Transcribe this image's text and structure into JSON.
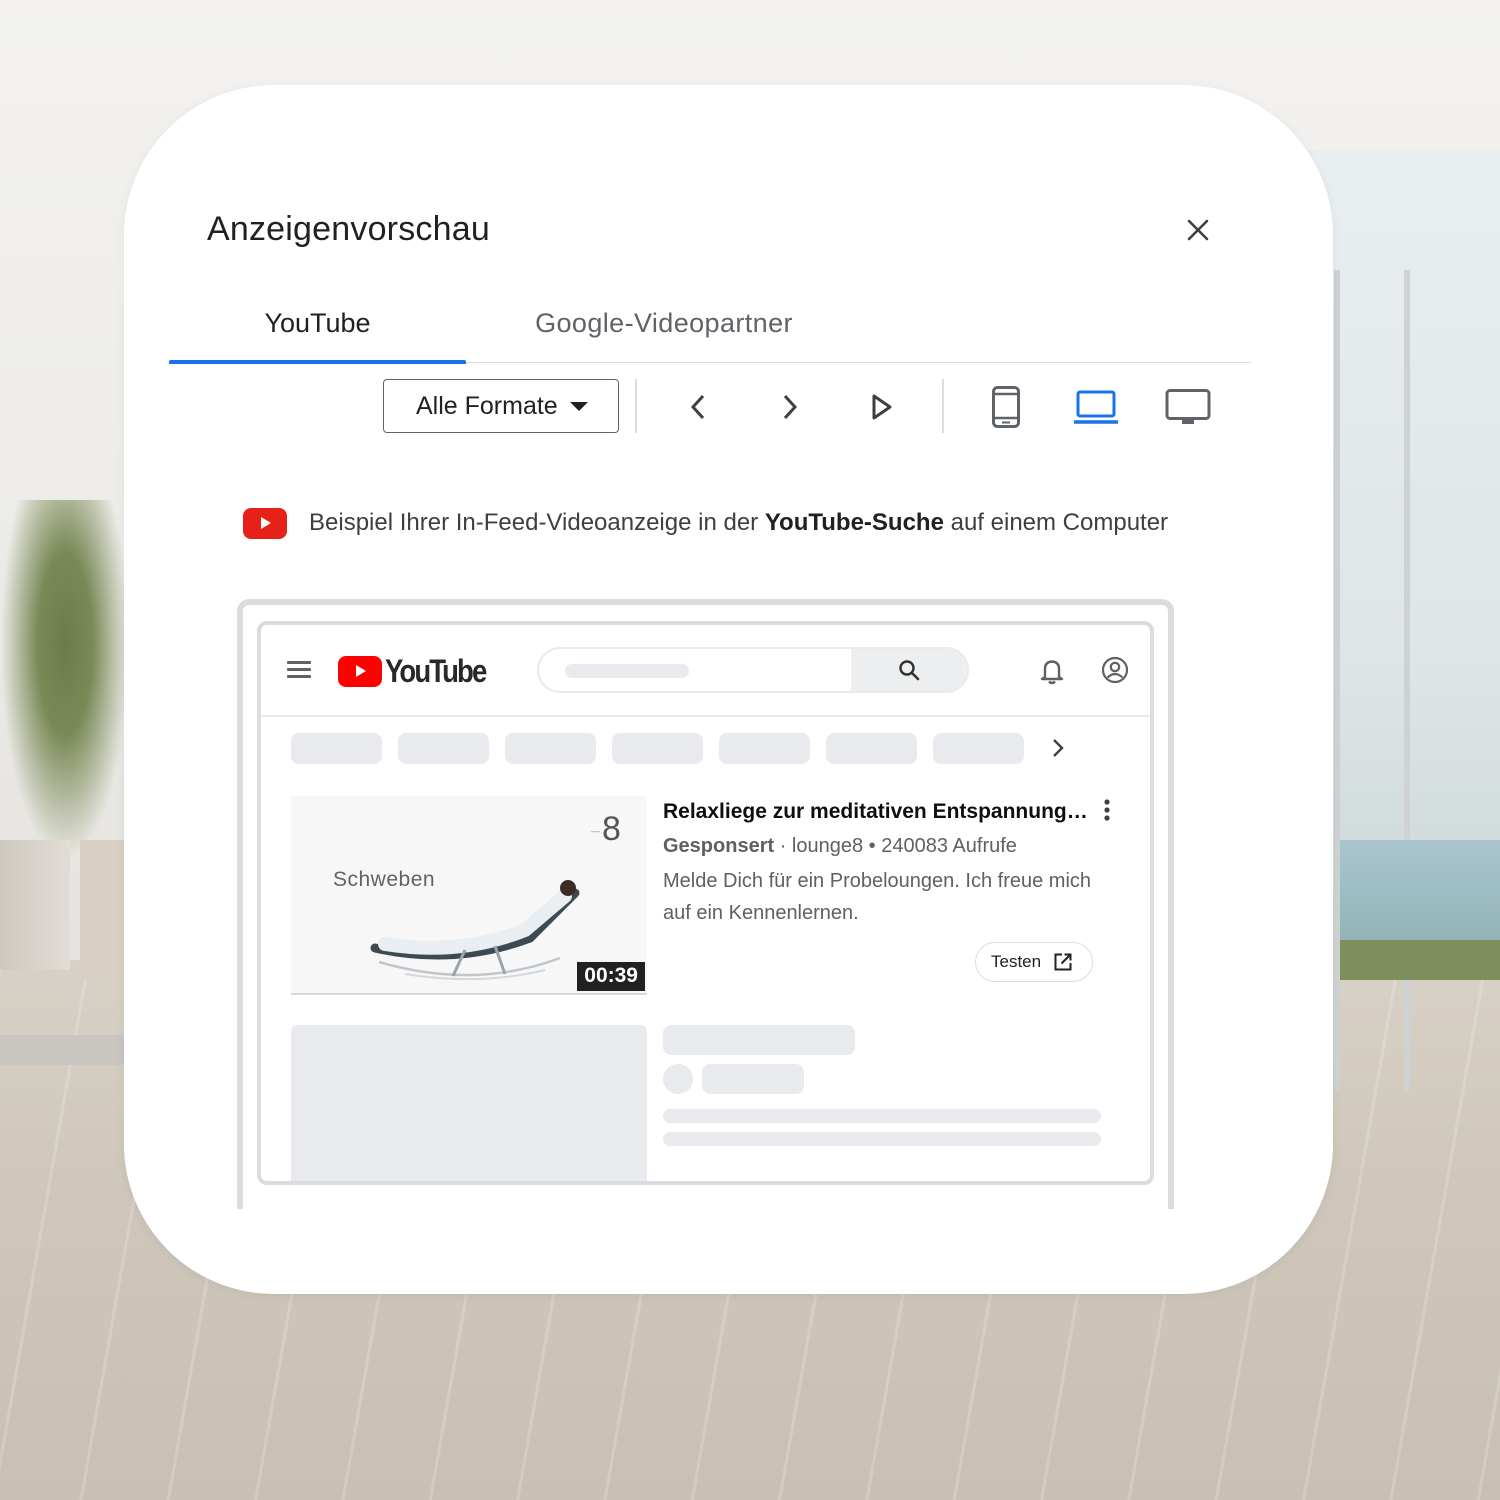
{
  "dialog": {
    "title": "Anzeigenvorschau",
    "close_icon": "close-icon"
  },
  "tabs": [
    {
      "label": "YouTube",
      "active": true
    },
    {
      "label": "Google-Videopartner",
      "active": false
    }
  ],
  "toolbar": {
    "format_select": {
      "value": "Alle Formate"
    },
    "icons": [
      "chevron-left-icon",
      "chevron-right-icon",
      "play-icon",
      "phone-icon",
      "laptop-icon",
      "monitor-icon"
    ],
    "selected_device": "laptop"
  },
  "info": {
    "prefix": "Beispiel Ihrer In-Feed-Videoanzeige in der ",
    "bold": "YouTube-Suche",
    "suffix": " auf einem Computer"
  },
  "preview": {
    "logo_text": "YouTube",
    "ad": {
      "thumbnail_brand": "8",
      "thumbnail_caption": "Schweben",
      "duration": "00:39",
      "title": "Relaxliege zur meditativen Entspannung…",
      "sponsored_label": "Gesponsert",
      "meta": " · lounge8 • 240083 Aufrufe",
      "description": "Melde Dich für ein Probeloungen. Ich freue mich auf ein Kennenlernen.",
      "cta_label": "Testen"
    }
  },
  "colors": {
    "accent": "#1a73e8",
    "youtube_red": "#ff0000",
    "placeholder_gray": "#e8eaed"
  }
}
